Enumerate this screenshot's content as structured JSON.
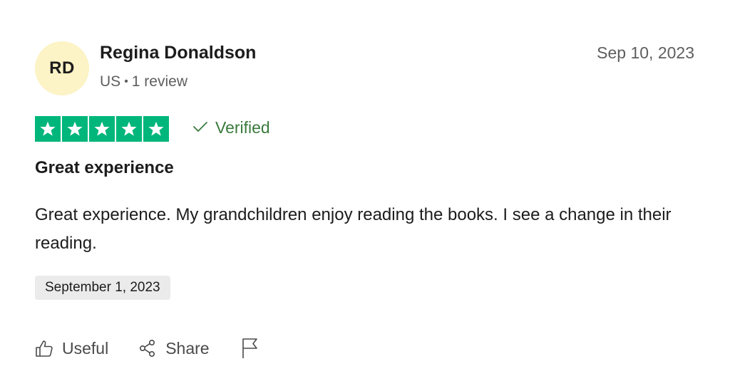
{
  "reviewer": {
    "initials": "RD",
    "avatar_color": "#fcf3c6",
    "name": "Regina Donaldson",
    "country": "US",
    "review_count_label": "1 review"
  },
  "review": {
    "date": "Sep 10, 2023",
    "rating": 5,
    "rating_max": 5,
    "star_color": "#00b67a",
    "verified_label": "Verified",
    "title": "Great experience",
    "body": "Great experience. My grandchildren enjoy reading the books. I see a change in their reading.",
    "experience_date": "September 1, 2023"
  },
  "actions": {
    "useful_label": "Useful",
    "useful_icon": "thumbs-up-icon",
    "share_label": "Share",
    "share_icon": "share-icon",
    "report_icon": "flag-icon"
  }
}
